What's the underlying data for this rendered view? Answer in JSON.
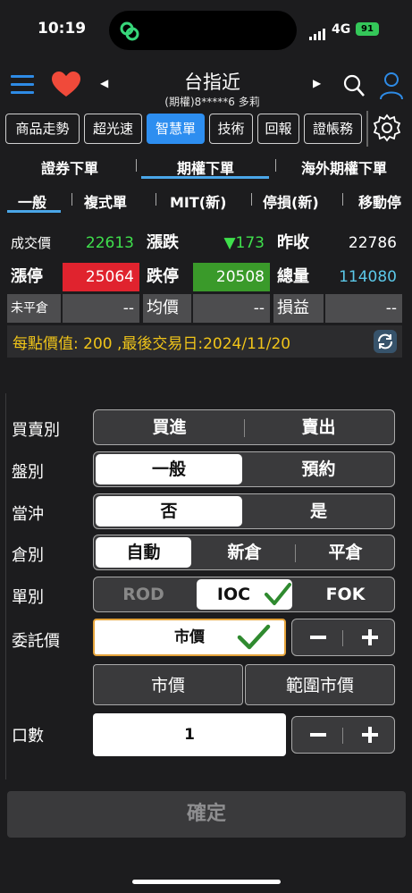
{
  "status_bar": {
    "time": "10:19",
    "network": "4G",
    "battery": "91"
  },
  "header": {
    "title": "台指近",
    "subtitle": "(期權)8*****6  多莉",
    "icons": [
      "menu-icon",
      "heart-icon",
      "search-icon",
      "user-icon"
    ]
  },
  "toolbar": {
    "buttons": [
      "商品走勢",
      "超光速",
      "智慧單",
      "技術",
      "回報",
      "證帳務"
    ],
    "active": "智慧單"
  },
  "order_tabs": [
    "證券下單",
    "期權下單",
    "海外期權下單"
  ],
  "order_tab_active": "期權下單",
  "sub_tabs": [
    "一般",
    "複式單",
    "MIT(新)",
    "停損(新)",
    "移動停"
  ],
  "sub_tab_active": "一般",
  "quote": {
    "last_label": "成交價",
    "last_value": "22613",
    "change_label": "漲跌",
    "change_value": "▼173",
    "prev_label": "昨收",
    "prev_value": "22786",
    "limit_up_label": "漲停",
    "limit_up_value": "25064",
    "limit_down_label": "跌停",
    "limit_down_value": "20508",
    "volume_label": "總量",
    "volume_value": "114080",
    "open_pos_label": "未平倉",
    "open_pos_value": "--",
    "avg_label": "均價",
    "avg_value": "--",
    "pnl_label": "損益",
    "pnl_value": "--"
  },
  "info_text": "每點價值: 200 ,最後交易日:2024/11/20",
  "colors": {
    "accent": "#2d8ef0",
    "up_red": "#e0232e",
    "down_green": "#3a9a2a",
    "info_yellow": "#f0c419"
  },
  "form": {
    "side_label": "買賣別",
    "side_options": [
      "買進",
      "賣出"
    ],
    "session_label": "盤別",
    "session_options": [
      "一般",
      "預約"
    ],
    "session_selected": "一般",
    "daytrade_label": "當沖",
    "daytrade_options": [
      "否",
      "是"
    ],
    "daytrade_selected": "否",
    "position_label": "倉別",
    "position_options": [
      "自動",
      "新倉",
      "平倉"
    ],
    "position_selected": "自動",
    "ordertype_label": "單別",
    "ordertype_options": [
      "ROD",
      "IOC",
      "FOK"
    ],
    "ordertype_selected": "IOC",
    "price_label": "委託價",
    "price_value": "市價",
    "quick_buttons": [
      "市價",
      "範圍市價"
    ],
    "qty_label": "口數",
    "qty_value": "1"
  },
  "confirm_label": "確定"
}
